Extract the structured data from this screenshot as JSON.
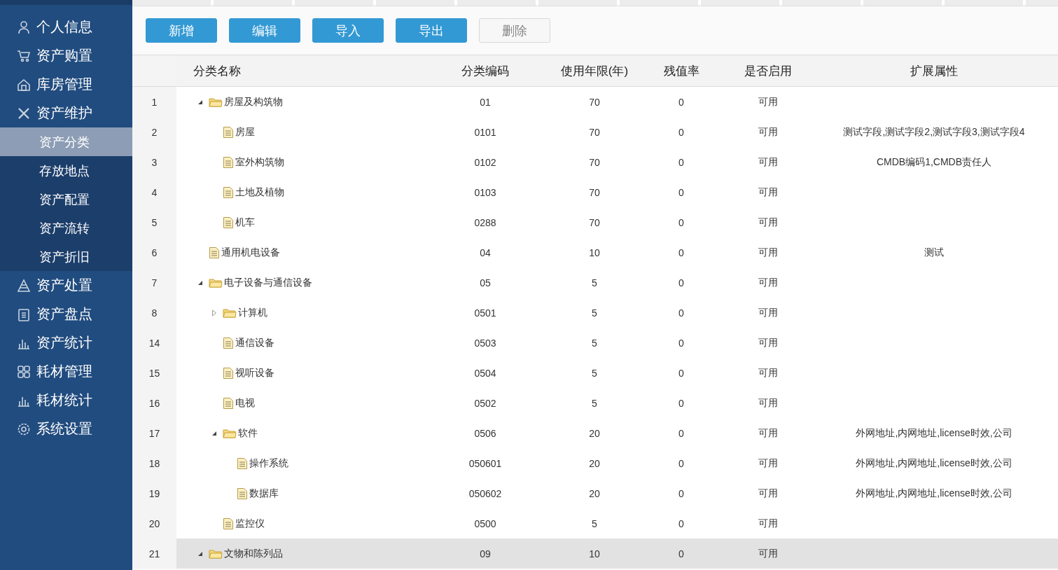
{
  "sidebar": {
    "items": [
      {
        "label": "个人信息",
        "selected": false
      },
      {
        "label": "资产购置",
        "selected": false
      },
      {
        "label": "库房管理",
        "selected": false
      },
      {
        "label": "资产维护",
        "selected": false,
        "expanded": true,
        "children": [
          {
            "label": "资产分类",
            "selected": true
          },
          {
            "label": "存放地点",
            "selected": false
          },
          {
            "label": "资产配置",
            "selected": false
          },
          {
            "label": "资产流转",
            "selected": false
          },
          {
            "label": "资产折旧",
            "selected": false
          }
        ]
      },
      {
        "label": "资产处置",
        "selected": false
      },
      {
        "label": "资产盘点",
        "selected": false
      },
      {
        "label": "资产统计",
        "selected": false
      },
      {
        "label": "耗材管理",
        "selected": false
      },
      {
        "label": "耗材统计",
        "selected": false
      },
      {
        "label": "系统设置",
        "selected": false
      }
    ]
  },
  "toolbar": {
    "buttons": [
      {
        "label": "新增",
        "disabled": false
      },
      {
        "label": "编辑",
        "disabled": false
      },
      {
        "label": "导入",
        "disabled": false
      },
      {
        "label": "导出",
        "disabled": false
      },
      {
        "label": "删除",
        "disabled": true
      }
    ]
  },
  "table": {
    "columns": [
      "分类名称",
      "分类编码",
      "使用年限(年)",
      "残值率",
      "是否启用",
      "扩展属性"
    ],
    "rows": [
      {
        "index": "1",
        "name": "房屋及构筑物",
        "kind": "folder",
        "expanded": true,
        "code": "01",
        "years": "70",
        "rate": "0",
        "enabled": "可用",
        "selected": false,
        "children": [
          {
            "index": "2",
            "name": "房屋",
            "kind": "file",
            "code": "0101",
            "years": "70",
            "rate": "0",
            "enabled": "可用",
            "ext": "测试字段,测试字段2,测试字段3,测试字段4",
            "selected": false
          },
          {
            "index": "3",
            "name": "室外构筑物",
            "kind": "file",
            "code": "0102",
            "years": "70",
            "rate": "0",
            "enabled": "可用",
            "ext": "CMDB编码1,CMDB责任人",
            "selected": false
          },
          {
            "index": "4",
            "name": "土地及植物",
            "kind": "file",
            "code": "0103",
            "years": "70",
            "rate": "0",
            "enabled": "可用",
            "selected": false
          },
          {
            "index": "5",
            "name": "机车",
            "kind": "file",
            "code": "0288",
            "years": "70",
            "rate": "0",
            "enabled": "可用",
            "selected": false
          }
        ]
      },
      {
        "index": "6",
        "name": "通用机电设备",
        "kind": "file",
        "code": "04",
        "years": "10",
        "rate": "0",
        "enabled": "可用",
        "ext": "测试",
        "selected": false
      },
      {
        "index": "7",
        "name": "电子设备与通信设备",
        "kind": "folder",
        "expanded": true,
        "code": "05",
        "years": "5",
        "rate": "0",
        "enabled": "可用",
        "selected": false,
        "children": [
          {
            "index": "8",
            "name": "计算机",
            "kind": "folder",
            "expanded": false,
            "code": "0501",
            "years": "5",
            "rate": "0",
            "enabled": "可用",
            "selected": false
          },
          {
            "index": "14",
            "name": "通信设备",
            "kind": "file",
            "code": "0503",
            "years": "5",
            "rate": "0",
            "enabled": "可用",
            "selected": false
          },
          {
            "index": "15",
            "name": "视听设备",
            "kind": "file",
            "code": "0504",
            "years": "5",
            "rate": "0",
            "enabled": "可用",
            "selected": false
          },
          {
            "index": "16",
            "name": "电视",
            "kind": "file",
            "code": "0502",
            "years": "5",
            "rate": "0",
            "enabled": "可用",
            "selected": false
          },
          {
            "index": "17",
            "name": "软件",
            "kind": "folder",
            "expanded": true,
            "code": "0506",
            "years": "20",
            "rate": "0",
            "enabled": "可用",
            "ext": "外网地址,内网地址,license时效,公司",
            "selected": false,
            "children": [
              {
                "index": "18",
                "name": "操作系统",
                "kind": "file",
                "code": "050601",
                "years": "20",
                "rate": "0",
                "enabled": "可用",
                "ext": "外网地址,内网地址,license时效,公司",
                "selected": false
              },
              {
                "index": "19",
                "name": "数据库",
                "kind": "file",
                "code": "050602",
                "years": "20",
                "rate": "0",
                "enabled": "可用",
                "ext": "外网地址,内网地址,license时效,公司",
                "selected": false
              }
            ]
          },
          {
            "index": "20",
            "name": "监控仪",
            "kind": "file",
            "code": "0500",
            "years": "5",
            "rate": "0",
            "enabled": "可用",
            "selected": false
          }
        ]
      },
      {
        "index": "21",
        "name": "文物和陈列品",
        "kind": "folder",
        "expanded": true,
        "code": "09",
        "years": "10",
        "rate": "0",
        "enabled": "可用",
        "selected": true
      }
    ]
  }
}
